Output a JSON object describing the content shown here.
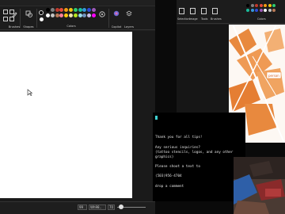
{
  "ribbon": {
    "brushes_label": "Brushes",
    "shapes_label": "Shapes",
    "colors_label": "Colors",
    "copilot_label": "Copilot",
    "layers_label": "Layers"
  },
  "palette_colors": [
    "#000000",
    "#7f7f7f",
    "#c0392b",
    "#e74c3c",
    "#f39c12",
    "#f1c40f",
    "#2ecc71",
    "#1abc9c",
    "#3498db",
    "#2e4cd8",
    "#9b59b6",
    "#ffffff",
    "#c3c3c3",
    "#b97a57",
    "#ff7f9c",
    "#ffc90e",
    "#efe4b0",
    "#b5e61d",
    "#99d9ea",
    "#7092be",
    "#c8bfe7",
    "#ff00ff"
  ],
  "status": {
    "zoom_box": "99",
    "view_box": "Wh98..",
    "zoom_small": "70"
  },
  "paint2": {
    "label_a": "Selection",
    "label_b": "Image",
    "label_c": "Tools",
    "label_d": "Brushes",
    "label_e": "Colors",
    "art_label": "person"
  },
  "chat": {
    "line1": "Thank you for all tips!",
    "line2": "Any serious inquiries?",
    "line3": "(tattoo stencils, logos, and any other",
    "line4": "graphics)",
    "line5": "Please shoot a text to",
    "line6": "(503)956-4704",
    "line7": "drop a comment"
  }
}
